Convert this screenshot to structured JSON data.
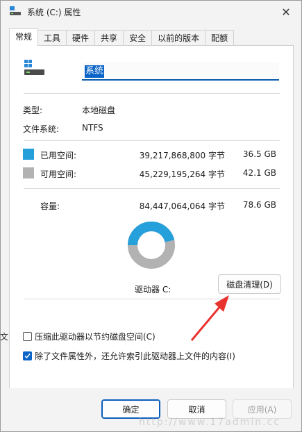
{
  "window": {
    "title": "系统 (C:) 属性",
    "close_glyph": "✕"
  },
  "tabs": [
    {
      "label": "常规",
      "active": true
    },
    {
      "label": "工具",
      "active": false
    },
    {
      "label": "硬件",
      "active": false
    },
    {
      "label": "共享",
      "active": false
    },
    {
      "label": "安全",
      "active": false
    },
    {
      "label": "以前的版本",
      "active": false
    },
    {
      "label": "配额",
      "active": false
    }
  ],
  "general": {
    "name_value": "系统",
    "type_label": "类型:",
    "type_value": "本地磁盘",
    "fs_label": "文件系统:",
    "fs_value": "NTFS",
    "used_label": "已用空间:",
    "used_bytes": "39,217,868,800 字节",
    "used_size": "36.5 GB",
    "free_label": "可用空间:",
    "free_bytes": "45,229,195,264 字节",
    "free_size": "42.1 GB",
    "capacity_label": "容量:",
    "capacity_bytes": "84,447,064,064 字节",
    "capacity_size": "78.6 GB",
    "drive_label": "驱动器 C:",
    "cleanup_button": "磁盘清理(D)",
    "compress_label": "压缩此驱动器以节约磁盘空间(C)",
    "compress_checked": false,
    "index_label": "除了文件属性外，还允许索引此驱动器上文件的内容(I)",
    "index_checked": true,
    "used_fraction": 0.464,
    "used_color": "#26a0da",
    "free_color": "#b2b2b2"
  },
  "footer": {
    "ok": "确定",
    "cancel": "取消",
    "apply": "应用(A)"
  },
  "watermark": "http://www.17admin.cc",
  "edge_text": "文"
}
